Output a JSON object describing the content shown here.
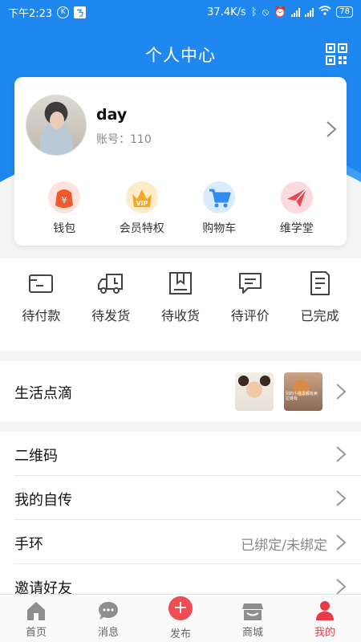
{
  "status_bar": {
    "time": "下午2:23",
    "network_speed": "37.4K/s",
    "battery": "78"
  },
  "header": {
    "title": "个人中心",
    "qr_icon": "qr-code-icon"
  },
  "profile": {
    "name": "day",
    "account_label": "账号：110"
  },
  "shortcuts": [
    {
      "label": "钱包",
      "icon": "wallet-icon",
      "color": "#f05a2c"
    },
    {
      "label": "会员特权",
      "icon": "vip-crown-icon",
      "color": "#f5a623"
    },
    {
      "label": "购物车",
      "icon": "shopping-cart-icon",
      "color": "#2f8cf2"
    },
    {
      "label": "维学堂",
      "icon": "paper-plane-icon",
      "color": "#ea4553"
    }
  ],
  "orders": [
    {
      "label": "待付款",
      "icon": "wallet-card-icon"
    },
    {
      "label": "待发货",
      "icon": "delivery-truck-icon"
    },
    {
      "label": "待收货",
      "icon": "package-icon"
    },
    {
      "label": "待评价",
      "icon": "comment-icon"
    },
    {
      "label": "已完成",
      "icon": "document-icon"
    }
  ],
  "life": {
    "title": "生活点滴",
    "thumb_caption": "别的小猫发都有卖拉链有"
  },
  "menu": [
    {
      "title": "二维码",
      "value": ""
    },
    {
      "title": "我的自传",
      "value": ""
    },
    {
      "title": "手环",
      "value": "已绑定/未绑定"
    },
    {
      "title": "邀请好友",
      "value": ""
    }
  ],
  "tabs": [
    {
      "label": "首页",
      "icon": "home-icon"
    },
    {
      "label": "消息",
      "icon": "message-icon"
    },
    {
      "label": "发布",
      "icon": "plus-icon"
    },
    {
      "label": "商城",
      "icon": "store-icon"
    },
    {
      "label": "我的",
      "icon": "profile-icon"
    }
  ],
  "colors": {
    "primary": "#1e88f0",
    "active_tab": "#e83b47"
  }
}
